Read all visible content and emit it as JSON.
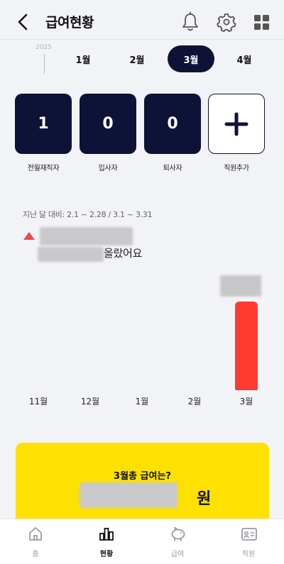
{
  "header": {
    "title": "급여현황",
    "icons": [
      "back-arrow-icon",
      "bell-icon",
      "gear-icon",
      "grid-icon"
    ]
  },
  "month_selector": {
    "year": "2025",
    "months": [
      "1월",
      "2월",
      "3월",
      "4월"
    ],
    "selected": "3월"
  },
  "stats": [
    {
      "value": "1",
      "label": "전월재직자"
    },
    {
      "value": "0",
      "label": "입사자"
    },
    {
      "value": "0",
      "label": "퇴사자"
    },
    {
      "value": "+",
      "label": "직원추가"
    }
  ],
  "comparison": {
    "label": "지난 달 대비: 2.1 ~ 2.28 / 3.1 ~ 3.31",
    "suffix": "올랐어요"
  },
  "chart_data": {
    "type": "bar",
    "categories": [
      "11월",
      "12월",
      "1월",
      "2월",
      "3월"
    ],
    "values": [
      0,
      0,
      0,
      0,
      100
    ],
    "title": "",
    "xlabel": "",
    "ylabel": ""
  },
  "total": {
    "title": "3월총 급여는?",
    "unit": "원"
  },
  "bottom_nav": [
    {
      "label": "홈",
      "icon": "home-icon",
      "active": false
    },
    {
      "label": "현황",
      "icon": "bar-chart-icon",
      "active": true
    },
    {
      "label": "급여",
      "icon": "piggy-bank-icon",
      "active": false
    },
    {
      "label": "직원",
      "icon": "id-card-icon",
      "active": false
    }
  ],
  "colors": {
    "navy": "#0f1237",
    "accent_red": "#ff3b30",
    "yellow": "#ffe100",
    "background": "#f2f3f7"
  }
}
